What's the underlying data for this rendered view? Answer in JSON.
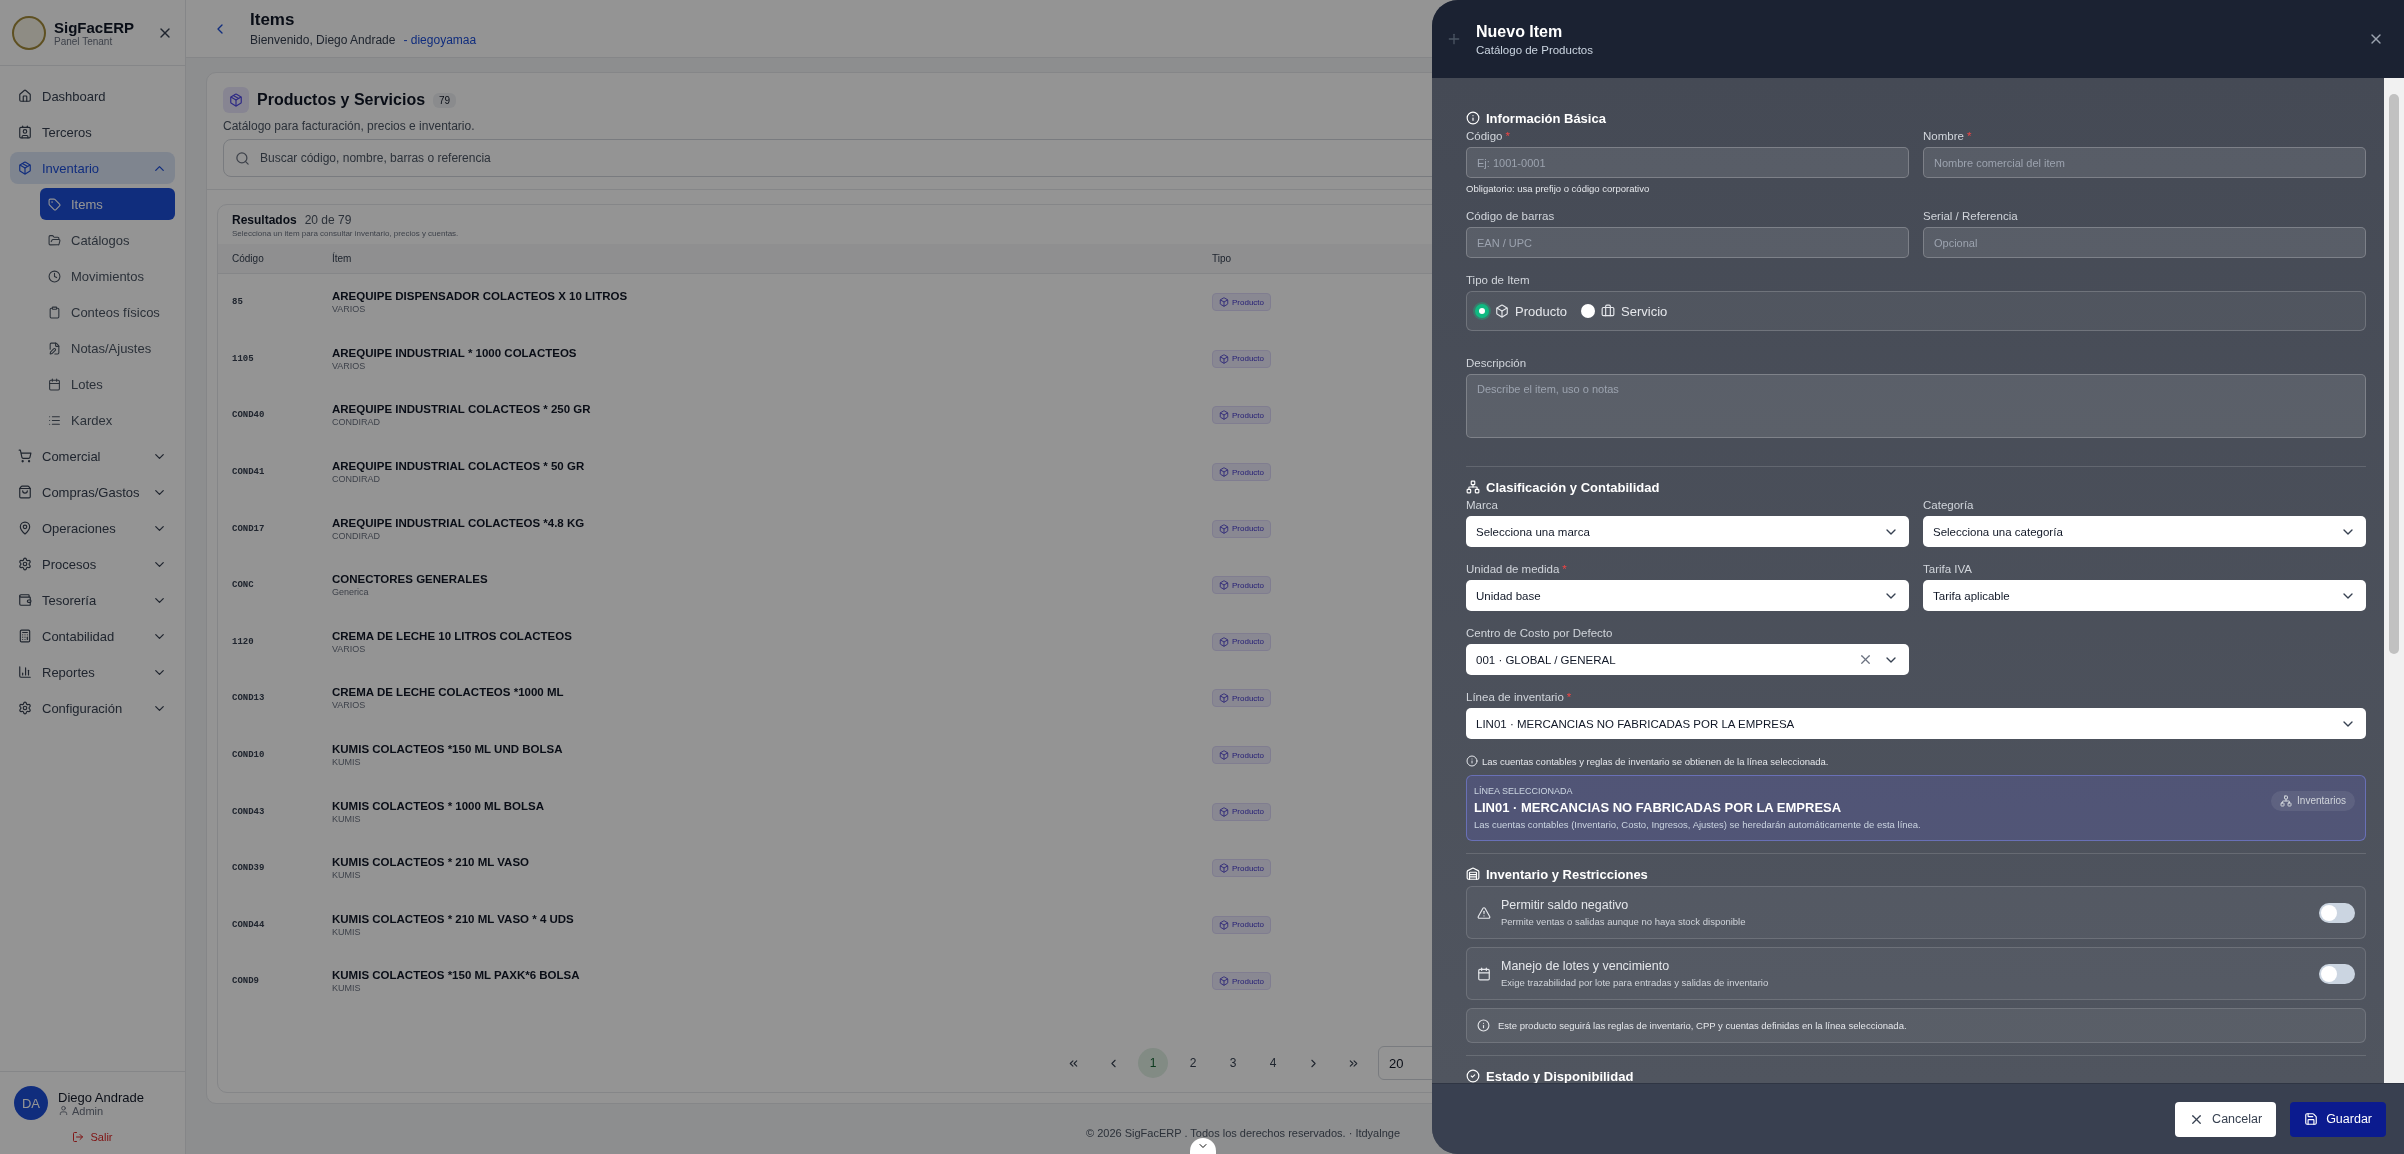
{
  "sidebar": {
    "brand": "SigFacERP",
    "subtitle": "Panel Tenant",
    "items": [
      {
        "label": "Dashboard",
        "kind": "link",
        "selected": false
      },
      {
        "label": "Terceros",
        "kind": "link",
        "selected": false
      },
      {
        "label": "Inventario",
        "kind": "group",
        "selected": true,
        "expanded": true,
        "children": [
          {
            "label": "Items",
            "selected": true
          },
          {
            "label": "Catálogos",
            "selected": false
          },
          {
            "label": "Movimientos",
            "selected": false
          },
          {
            "label": "Conteos físicos",
            "selected": false
          },
          {
            "label": "Notas/Ajustes",
            "selected": false
          },
          {
            "label": "Lotes",
            "selected": false
          },
          {
            "label": "Kardex",
            "selected": false
          }
        ]
      },
      {
        "label": "Comercial",
        "kind": "group",
        "selected": false,
        "expanded": false
      },
      {
        "label": "Compras/Gastos",
        "kind": "group",
        "selected": false,
        "expanded": false
      },
      {
        "label": "Operaciones",
        "kind": "group",
        "selected": false,
        "expanded": false
      },
      {
        "label": "Procesos",
        "kind": "group",
        "selected": false,
        "expanded": false
      },
      {
        "label": "Tesorería",
        "kind": "group",
        "selected": false,
        "expanded": false
      },
      {
        "label": "Contabilidad",
        "kind": "group",
        "selected": false,
        "expanded": false
      },
      {
        "label": "Reportes",
        "kind": "group",
        "selected": false,
        "expanded": false
      },
      {
        "label": "Configuración",
        "kind": "group",
        "selected": false,
        "expanded": false
      }
    ],
    "user": {
      "initials": "DA",
      "name": "Diego Andrade",
      "role": "Admin",
      "logout": "Salir"
    }
  },
  "header": {
    "title": "Items",
    "welcome": "Bienvenido, Diego Andrade",
    "user_link": "- diegoyamaa"
  },
  "catalog": {
    "title": "Productos y Servicios",
    "count": "79",
    "subtitle": "Catálogo para facturación, precios e inventario.",
    "search": {
      "placeholder": "Buscar código, nombre, barras o referencia"
    },
    "results": {
      "title": "Resultados",
      "count": "20 de 79",
      "hint": "Selecciona un item para consultar inventario, precios y cuentas.",
      "columns": [
        "Código",
        "Ítem",
        "Tipo"
      ],
      "rows": [
        {
          "code": "85",
          "name": "AREQUIPE DISPENSADOR COLACTEOS X 10 LITROS",
          "group": "VARIOS",
          "type": "Producto"
        },
        {
          "code": "1105",
          "name": "AREQUIPE INDUSTRIAL * 1000 COLACTEOS",
          "group": "VARIOS",
          "type": "Producto"
        },
        {
          "code": "COND40",
          "name": "AREQUIPE INDUSTRIAL COLACTEOS * 250 GR",
          "group": "CONDIRAD",
          "type": "Producto"
        },
        {
          "code": "COND41",
          "name": "AREQUIPE INDUSTRIAL COLACTEOS * 50 GR",
          "group": "CONDIRAD",
          "type": "Producto"
        },
        {
          "code": "COND17",
          "name": "AREQUIPE INDUSTRIAL COLACTEOS *4.8 KG",
          "group": "CONDIRAD",
          "type": "Producto"
        },
        {
          "code": "CONC",
          "name": "CONECTORES GENERALES",
          "group": "Generica",
          "type": "Producto"
        },
        {
          "code": "1120",
          "name": "CREMA DE LECHE 10 LITROS COLACTEOS",
          "group": "VARIOS",
          "type": "Producto"
        },
        {
          "code": "COND13",
          "name": "CREMA DE LECHE COLACTEOS *1000 ML",
          "group": "VARIOS",
          "type": "Producto"
        },
        {
          "code": "COND10",
          "name": "KUMIS COLACTEOS *150 ML UND BOLSA",
          "group": "KUMIS",
          "type": "Producto"
        },
        {
          "code": "COND43",
          "name": "KUMIS COLACTEOS * 1000 ML BOLSA",
          "group": "KUMIS",
          "type": "Producto"
        },
        {
          "code": "COND39",
          "name": "KUMIS COLACTEOS * 210 ML VASO",
          "group": "KUMIS",
          "type": "Producto"
        },
        {
          "code": "COND44",
          "name": "KUMIS COLACTEOS * 210 ML VASO * 4 UDS",
          "group": "KUMIS",
          "type": "Producto"
        },
        {
          "code": "COND9",
          "name": "KUMIS COLACTEOS *150 ML PAXK*6 BOLSA",
          "group": "KUMIS",
          "type": "Producto"
        }
      ],
      "pages": [
        {
          "label": "1",
          "selected": true
        },
        {
          "label": "2",
          "selected": false
        },
        {
          "label": "3",
          "selected": false
        },
        {
          "label": "4",
          "selected": false
        }
      ],
      "page_size": "20"
    }
  },
  "footer": "© 2026 SigFacERP . Todos los derechos reservados. · Itdyalnge",
  "drawer": {
    "title": "Nuevo Item",
    "subtitle": "Catálogo de Productos",
    "required_mark": "*",
    "basic": {
      "title": "Información Básica",
      "fields": [
        {
          "label": "Código",
          "required": true,
          "placeholder": "Ej: 1001-0001",
          "hint": "Obligatorio: usa prefijo o código corporativo"
        },
        {
          "label": "Nombre",
          "required": true,
          "placeholder": "Nombre comercial del item"
        },
        {
          "label": "Código de barras",
          "required": false,
          "placeholder": "EAN / UPC"
        },
        {
          "label": "Serial / Referencia",
          "required": false,
          "placeholder": "Opcional"
        }
      ],
      "type_label": "Tipo de Item",
      "types": [
        {
          "label": "Producto",
          "selected": true
        },
        {
          "label": "Servicio",
          "selected": false
        }
      ],
      "description": {
        "label": "Descripción",
        "placeholder": "Describe el item, uso o notas"
      }
    },
    "classification": {
      "title": "Clasificación y Contabilidad",
      "selects": [
        {
          "label": "Marca",
          "required": false,
          "value": "Selecciona una marca",
          "clearable": false
        },
        {
          "label": "Categoría",
          "required": false,
          "value": "Selecciona una categoría",
          "clearable": false
        },
        {
          "label": "Unidad de medida",
          "required": true,
          "value": "Unidad base",
          "clearable": false
        },
        {
          "label": "Tarifa IVA",
          "required": false,
          "value": "Tarifa aplicable",
          "clearable": false
        },
        {
          "label": "Centro de Costo por Defecto",
          "required": false,
          "value": "001 · GLOBAL / GENERAL",
          "clearable": true
        }
      ],
      "line": {
        "label": "Línea de inventario",
        "required": true,
        "value": "LIN01 · MERCANCIAS NO FABRICADAS POR LA EMPRESA"
      },
      "note": "Las cuentas contables y reglas de inventario se obtienen de la línea seleccionada.",
      "selected_line": {
        "eyebrow": "LÍNEA SELECCIONADA",
        "title": "LIN01 · MERCANCIAS NO FABRICADAS POR LA EMPRESA",
        "description": "Las cuentas contables (Inventario, Costo, Ingresos, Ajustes) se heredarán automáticamente de esta línea.",
        "badge": "Inventarios"
      }
    },
    "inventory": {
      "title": "Inventario y Restricciones",
      "toggles": [
        {
          "title": "Permitir saldo negativo",
          "description": "Permite ventas o salidas aunque no haya stock disponible",
          "on": false
        },
        {
          "title": "Manejo de lotes y vencimiento",
          "description": "Exige trazabilidad por lote para entradas y salidas de inventario",
          "on": false
        }
      ],
      "info": "Este producto seguirá las reglas de inventario, CPP y cuentas definidas en la línea seleccionada."
    },
    "status": {
      "title": "Estado y Disponibilidad"
    },
    "buttons": {
      "cancel": "Cancelar",
      "save": "Guardar"
    }
  }
}
